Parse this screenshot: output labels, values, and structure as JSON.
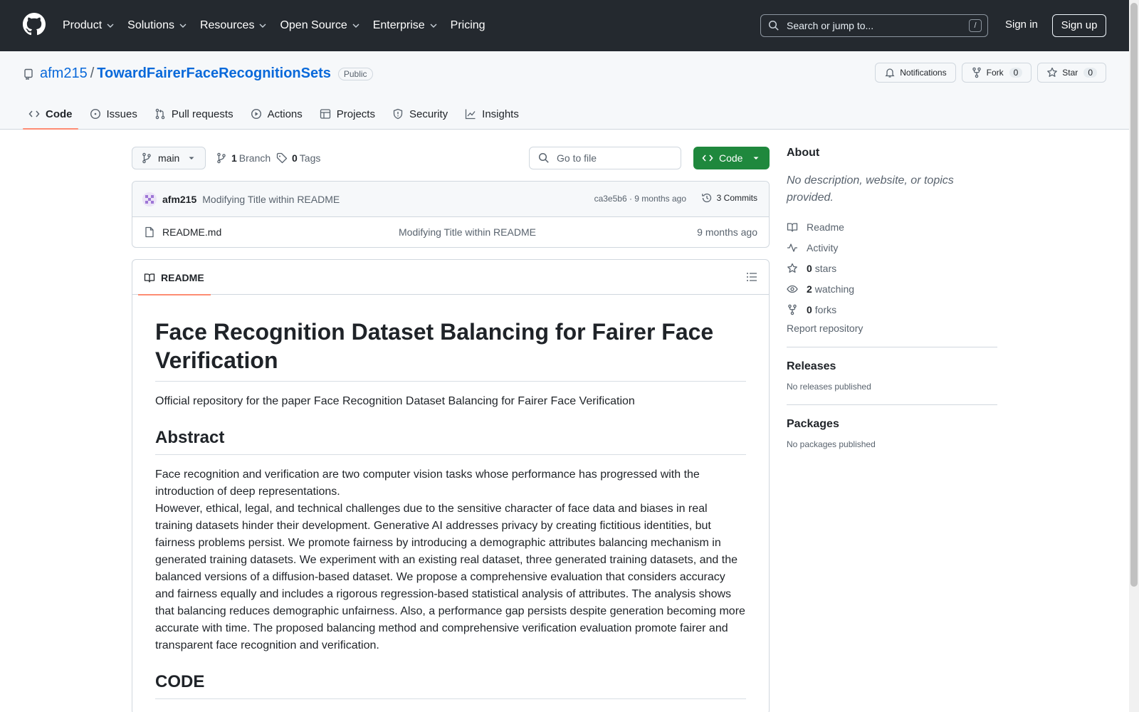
{
  "header": {
    "nav": [
      {
        "label": "Product"
      },
      {
        "label": "Solutions"
      },
      {
        "label": "Resources"
      },
      {
        "label": "Open Source"
      },
      {
        "label": "Enterprise"
      },
      {
        "label": "Pricing"
      }
    ],
    "search_placeholder": "Search or jump to...",
    "search_shortcut": "/",
    "signin": "Sign in",
    "signup": "Sign up"
  },
  "repo": {
    "owner": "afm215",
    "separator": "/",
    "name": "TowardFairerFaceRecognitionSets",
    "visibility": "Public",
    "notifications_label": "Notifications",
    "fork_label": "Fork",
    "fork_count": "0",
    "star_label": "Star",
    "star_count": "0",
    "tabs": [
      {
        "label": "Code"
      },
      {
        "label": "Issues"
      },
      {
        "label": "Pull requests"
      },
      {
        "label": "Actions"
      },
      {
        "label": "Projects"
      },
      {
        "label": "Security"
      },
      {
        "label": "Insights"
      }
    ]
  },
  "toolbar": {
    "branch": "main",
    "branch_count": "1",
    "branch_label": "Branch",
    "tag_count": "0",
    "tag_label": "Tags",
    "goto_placeholder": "Go to file",
    "code_button": "Code"
  },
  "commit": {
    "author": "afm215",
    "message": "Modifying Title within README",
    "meta": "ca3e5b6 · 9 months ago",
    "count_label": "3 Commits"
  },
  "files": [
    {
      "name": "README.md",
      "message": "Modifying Title within README",
      "time": "9 months ago"
    }
  ],
  "readme": {
    "tab_label": "README",
    "title": "Face Recognition Dataset Balancing for Fairer Face Verification",
    "intro": "Official repository for the paper Face Recognition Dataset Balancing for Fairer Face Verification",
    "abstract_heading": "Abstract",
    "abstract_p1": "Face recognition and verification are two computer vision tasks whose performance has progressed with the introduction of deep representations.",
    "abstract_p2": "However, ethical, legal, and technical challenges due to the sensitive character of face data and biases in real training datasets hinder their development. Generative AI addresses privacy by creating fictitious identities, but fairness problems persist. We promote fairness by introducing a demographic attributes balancing mechanism in generated training datasets. We experiment with an existing real dataset, three generated training datasets, and the balanced versions of a diffusion-based dataset. We propose a comprehensive evaluation that considers accuracy and fairness equally and includes a rigorous regression-based statistical analysis of attributes. The analysis shows that balancing reduces demographic unfairness. Also, a performance gap persists despite generation becoming more accurate with time. The proposed balancing method and comprehensive verification evaluation promote fairer and transparent face recognition and verification.",
    "code_heading": "CODE"
  },
  "about": {
    "heading": "About",
    "description": "No description, website, or topics provided.",
    "links": [
      {
        "bold": "",
        "label": "Readme"
      },
      {
        "bold": "",
        "label": "Activity"
      },
      {
        "bold": "0",
        "label": "stars"
      },
      {
        "bold": "2",
        "label": "watching"
      },
      {
        "bold": "0",
        "label": "forks"
      }
    ],
    "report": "Report repository"
  },
  "releases": {
    "heading": "Releases",
    "text": "No releases published"
  },
  "packages": {
    "heading": "Packages",
    "text": "No packages published"
  },
  "colors": {
    "header_bg": "#24292f",
    "accent_link": "#0969da",
    "code_button": "#1f883d",
    "tab_underline": "#fd8c73"
  }
}
